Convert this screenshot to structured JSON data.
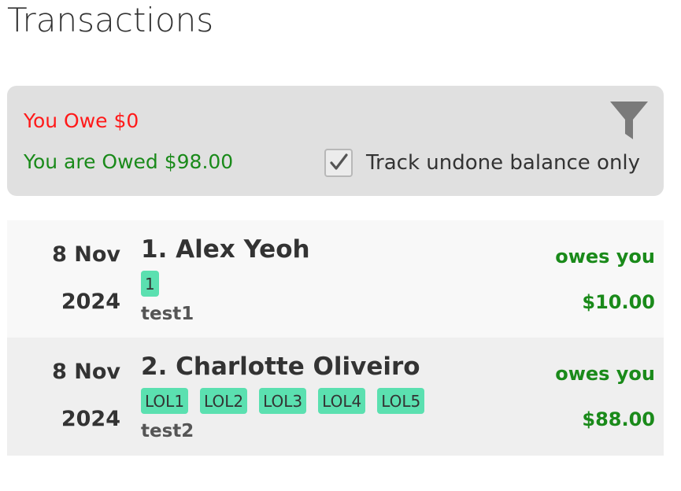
{
  "page": {
    "title": "Transactions"
  },
  "summary": {
    "you_owe": "You Owe $0",
    "you_are_owed": "You are Owed $98.00",
    "track_label": "Track undone balance only",
    "track_checked": true,
    "filter_icon": "filter-funnel-icon"
  },
  "colors": {
    "owe_red": "#ff1a1a",
    "owed_green": "#1a8a1a",
    "tag_teal": "#5be0b0",
    "panel_gray": "#e0e0e0"
  },
  "transactions": [
    {
      "date_day": "8 Nov",
      "date_year": "2024",
      "name": "1. Alex Yeoh",
      "tags": [
        "1"
      ],
      "description": "test1",
      "status": "owes you",
      "amount": "$10.00"
    },
    {
      "date_day": "8 Nov",
      "date_year": "2024",
      "name": "2. Charlotte Oliveiro",
      "tags": [
        "LOL1",
        "LOL2",
        "LOL3",
        "LOL4",
        "LOL5"
      ],
      "description": "test2",
      "status": "owes you",
      "amount": "$88.00"
    }
  ]
}
